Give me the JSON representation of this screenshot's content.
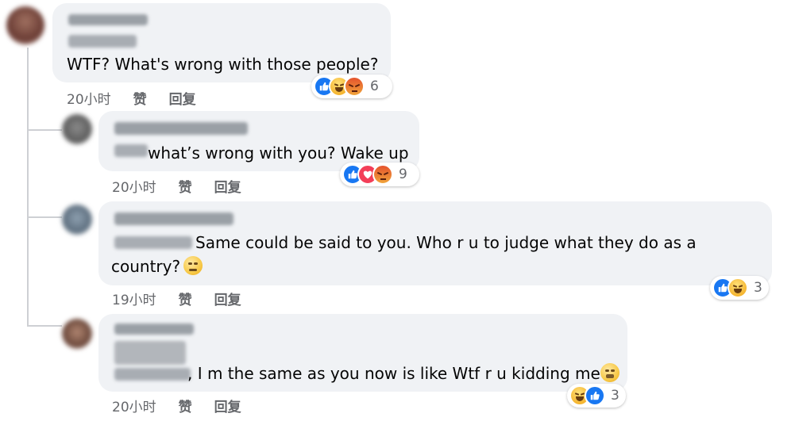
{
  "comments": [
    {
      "text": "WTF? What's wrong with those people?",
      "time": "20小时",
      "like_label": "赞",
      "reply_label": "回复",
      "reaction_count": "6"
    },
    {
      "text": "what’s wrong with you? Wake up",
      "time": "20小时",
      "like_label": "赞",
      "reply_label": "回复",
      "reaction_count": "9"
    },
    {
      "text_line1": "Same could be said to you. Who r u to judge what they do as a",
      "text_line2": "country?",
      "time": "19小时",
      "like_label": "赞",
      "reply_label": "回复",
      "reaction_count": "3"
    },
    {
      "text": ", I m the same as you now is like Wtf r u kidding me",
      "time": "20小时",
      "like_label": "赞",
      "reply_label": "回复",
      "reaction_count": "3"
    }
  ],
  "colors": {
    "bubble": "#f0f2f5",
    "meta_text": "#65676b",
    "like_blue": "#1877f2",
    "thread_line": "#ced0d4"
  },
  "icons": [
    "like-reaction-icon",
    "haha-reaction-icon",
    "angry-reaction-icon",
    "love-reaction-icon",
    "rolling-eyes-emoji-icon",
    "grimace-emoji-icon"
  ]
}
